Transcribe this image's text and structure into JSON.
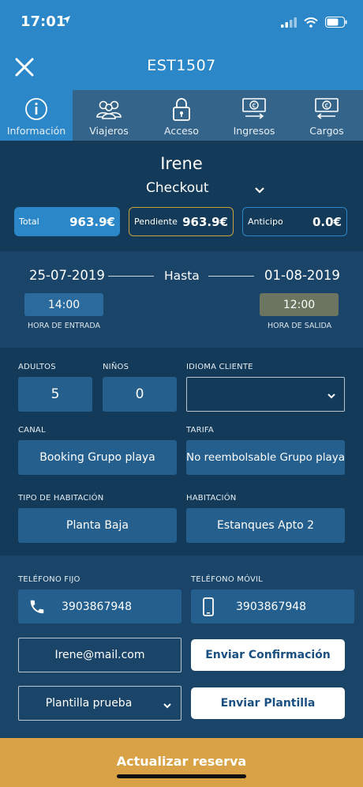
{
  "status_bar": {
    "time": "17:01"
  },
  "header": {
    "title": "EST1507"
  },
  "tabs": [
    {
      "label": "Información",
      "icon": "info-icon",
      "active": true
    },
    {
      "label": "Viajeros",
      "icon": "people-icon",
      "active": false
    },
    {
      "label": "Acceso",
      "icon": "lock-icon",
      "active": false
    },
    {
      "label": "Ingresos",
      "icon": "money-in-icon",
      "active": false
    },
    {
      "label": "Cargos",
      "icon": "money-out-icon",
      "active": false
    }
  ],
  "reservation": {
    "guest_name": "Irene",
    "status": "Checkout",
    "total_label": "Total",
    "total_value": "963.9€",
    "pending_label": "Pendiente",
    "pending_value": "963.9€",
    "advance_label": "Anticipo",
    "advance_value": "0.0€"
  },
  "dates": {
    "from": "25-07-2019",
    "to_word": "Hasta",
    "to": "01-08-2019",
    "checkin_time": "14:00",
    "checkin_label": "HORA DE ENTRADA",
    "checkout_time": "12:00",
    "checkout_label": "HORA DE SALIDA"
  },
  "fields": {
    "adults_label": "ADULTOS",
    "adults_value": "5",
    "children_label": "NIÑOS",
    "children_value": "0",
    "language_label": "IDIOMA CLIENTE",
    "language_value": "",
    "channel_label": "CANAL",
    "channel_value": "Booking Grupo playa",
    "rate_label": "TARIFA",
    "rate_value": "No reembolsable Grupo playa",
    "room_type_label": "TIPO DE HABITACIÓN",
    "room_type_value": "Planta Baja",
    "room_label": "HABITACIÓN",
    "room_value": "Estanques Apto 2"
  },
  "contact": {
    "landline_label": "TELÉFONO FIJO",
    "landline_value": "3903867948",
    "mobile_label": "TELÉFONO MÓVIL",
    "mobile_value": "3903867948",
    "email_value": "Irene@mail.com",
    "send_confirmation_label": "Enviar Confirmación",
    "template_value": "Plantilla prueba",
    "send_template_label": "Enviar Plantilla"
  },
  "footer": {
    "update_label": "Actualizar reserva"
  },
  "colors": {
    "primary": "#2b87c8",
    "navy": "#133a59",
    "accent": "#d9a246",
    "pending_border": "#c8a23c"
  }
}
